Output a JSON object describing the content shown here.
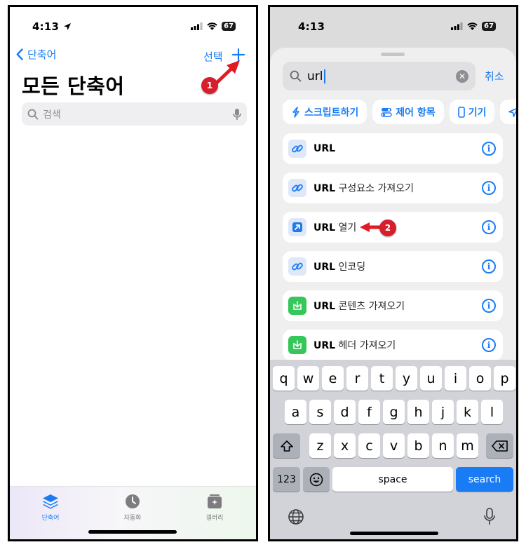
{
  "left_screen": {
    "status": {
      "time": "4:13",
      "battery": "67"
    },
    "nav": {
      "back_label": "단축어",
      "select_label": "선택"
    },
    "title": "모든 단축어",
    "search": {
      "placeholder": "검색"
    },
    "annotation_badge": "1",
    "tabs": [
      {
        "label": "단축어",
        "icon": "layers-icon",
        "active": true
      },
      {
        "label": "자동화",
        "icon": "clock-icon",
        "active": false
      },
      {
        "label": "갤러리",
        "icon": "gallery-icon",
        "active": false
      }
    ]
  },
  "right_screen": {
    "status": {
      "time": "4:13",
      "battery": "67"
    },
    "search": {
      "value": "url",
      "cancel_label": "취소"
    },
    "chips": [
      {
        "label": "스크립트하기",
        "icon": "script-icon"
      },
      {
        "label": "제어 항목",
        "icon": "toggle-icon"
      },
      {
        "label": "기기",
        "icon": "phone-icon"
      }
    ],
    "actions": [
      {
        "prefix": "URL",
        "suffix": "",
        "icon": "link-icon",
        "icon_color": "#dfe8f8"
      },
      {
        "prefix": "URL",
        "suffix": "구성요소 가져오기",
        "icon": "link-icon",
        "icon_color": "#dfe8f8"
      },
      {
        "prefix": "URL",
        "suffix": "열기",
        "icon": "open-arrow-icon",
        "icon_color": "#1f7ae8"
      },
      {
        "prefix": "URL",
        "suffix": "인코딩",
        "icon": "link-icon",
        "icon_color": "#dfe8f8"
      },
      {
        "prefix": "URL",
        "suffix": "콘텐츠 가져오기",
        "icon": "download-icon",
        "icon_color": "#35c759"
      },
      {
        "prefix": "URL",
        "suffix": "헤더 가져오기",
        "icon": "download-icon",
        "icon_color": "#35c759"
      }
    ],
    "annotation_badge": "2",
    "keyboard": {
      "row1": [
        "q",
        "w",
        "e",
        "r",
        "t",
        "y",
        "u",
        "i",
        "o",
        "p"
      ],
      "row2": [
        "a",
        "s",
        "d",
        "f",
        "g",
        "h",
        "j",
        "k",
        "l"
      ],
      "row3": [
        "z",
        "x",
        "c",
        "v",
        "b",
        "n",
        "m"
      ],
      "numbers_label": "123",
      "space_label": "space",
      "search_label": "search"
    }
  },
  "colors": {
    "accent": "#1a7cf5",
    "annotation_red": "#d61e2d"
  }
}
